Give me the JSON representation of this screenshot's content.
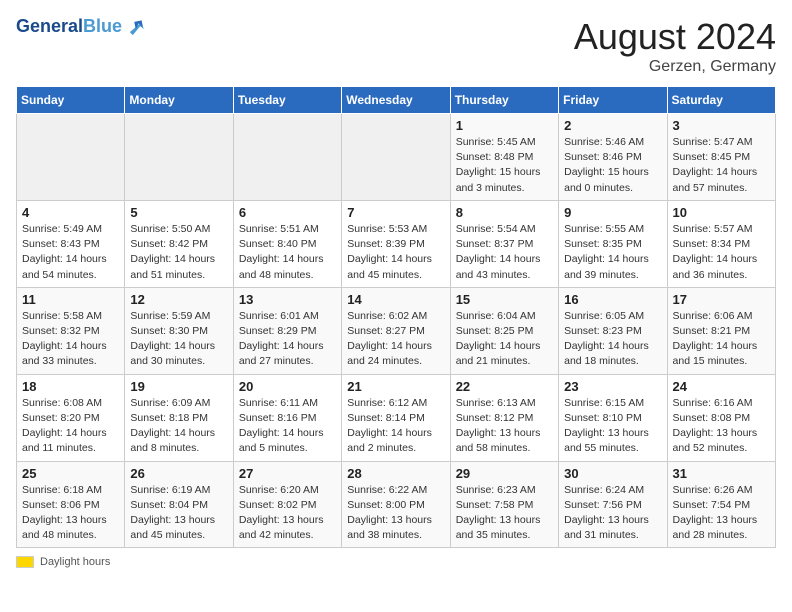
{
  "header": {
    "logo_line1": "General",
    "logo_line2": "Blue",
    "month_title": "August 2024",
    "location": "Gerzen, Germany"
  },
  "days_of_week": [
    "Sunday",
    "Monday",
    "Tuesday",
    "Wednesday",
    "Thursday",
    "Friday",
    "Saturday"
  ],
  "weeks": [
    [
      {
        "day": "",
        "info": ""
      },
      {
        "day": "",
        "info": ""
      },
      {
        "day": "",
        "info": ""
      },
      {
        "day": "",
        "info": ""
      },
      {
        "day": "1",
        "info": "Sunrise: 5:45 AM\nSunset: 8:48 PM\nDaylight: 15 hours\nand 3 minutes."
      },
      {
        "day": "2",
        "info": "Sunrise: 5:46 AM\nSunset: 8:46 PM\nDaylight: 15 hours\nand 0 minutes."
      },
      {
        "day": "3",
        "info": "Sunrise: 5:47 AM\nSunset: 8:45 PM\nDaylight: 14 hours\nand 57 minutes."
      }
    ],
    [
      {
        "day": "4",
        "info": "Sunrise: 5:49 AM\nSunset: 8:43 PM\nDaylight: 14 hours\nand 54 minutes."
      },
      {
        "day": "5",
        "info": "Sunrise: 5:50 AM\nSunset: 8:42 PM\nDaylight: 14 hours\nand 51 minutes."
      },
      {
        "day": "6",
        "info": "Sunrise: 5:51 AM\nSunset: 8:40 PM\nDaylight: 14 hours\nand 48 minutes."
      },
      {
        "day": "7",
        "info": "Sunrise: 5:53 AM\nSunset: 8:39 PM\nDaylight: 14 hours\nand 45 minutes."
      },
      {
        "day": "8",
        "info": "Sunrise: 5:54 AM\nSunset: 8:37 PM\nDaylight: 14 hours\nand 43 minutes."
      },
      {
        "day": "9",
        "info": "Sunrise: 5:55 AM\nSunset: 8:35 PM\nDaylight: 14 hours\nand 39 minutes."
      },
      {
        "day": "10",
        "info": "Sunrise: 5:57 AM\nSunset: 8:34 PM\nDaylight: 14 hours\nand 36 minutes."
      }
    ],
    [
      {
        "day": "11",
        "info": "Sunrise: 5:58 AM\nSunset: 8:32 PM\nDaylight: 14 hours\nand 33 minutes."
      },
      {
        "day": "12",
        "info": "Sunrise: 5:59 AM\nSunset: 8:30 PM\nDaylight: 14 hours\nand 30 minutes."
      },
      {
        "day": "13",
        "info": "Sunrise: 6:01 AM\nSunset: 8:29 PM\nDaylight: 14 hours\nand 27 minutes."
      },
      {
        "day": "14",
        "info": "Sunrise: 6:02 AM\nSunset: 8:27 PM\nDaylight: 14 hours\nand 24 minutes."
      },
      {
        "day": "15",
        "info": "Sunrise: 6:04 AM\nSunset: 8:25 PM\nDaylight: 14 hours\nand 21 minutes."
      },
      {
        "day": "16",
        "info": "Sunrise: 6:05 AM\nSunset: 8:23 PM\nDaylight: 14 hours\nand 18 minutes."
      },
      {
        "day": "17",
        "info": "Sunrise: 6:06 AM\nSunset: 8:21 PM\nDaylight: 14 hours\nand 15 minutes."
      }
    ],
    [
      {
        "day": "18",
        "info": "Sunrise: 6:08 AM\nSunset: 8:20 PM\nDaylight: 14 hours\nand 11 minutes."
      },
      {
        "day": "19",
        "info": "Sunrise: 6:09 AM\nSunset: 8:18 PM\nDaylight: 14 hours\nand 8 minutes."
      },
      {
        "day": "20",
        "info": "Sunrise: 6:11 AM\nSunset: 8:16 PM\nDaylight: 14 hours\nand 5 minutes."
      },
      {
        "day": "21",
        "info": "Sunrise: 6:12 AM\nSunset: 8:14 PM\nDaylight: 14 hours\nand 2 minutes."
      },
      {
        "day": "22",
        "info": "Sunrise: 6:13 AM\nSunset: 8:12 PM\nDaylight: 13 hours\nand 58 minutes."
      },
      {
        "day": "23",
        "info": "Sunrise: 6:15 AM\nSunset: 8:10 PM\nDaylight: 13 hours\nand 55 minutes."
      },
      {
        "day": "24",
        "info": "Sunrise: 6:16 AM\nSunset: 8:08 PM\nDaylight: 13 hours\nand 52 minutes."
      }
    ],
    [
      {
        "day": "25",
        "info": "Sunrise: 6:18 AM\nSunset: 8:06 PM\nDaylight: 13 hours\nand 48 minutes."
      },
      {
        "day": "26",
        "info": "Sunrise: 6:19 AM\nSunset: 8:04 PM\nDaylight: 13 hours\nand 45 minutes."
      },
      {
        "day": "27",
        "info": "Sunrise: 6:20 AM\nSunset: 8:02 PM\nDaylight: 13 hours\nand 42 minutes."
      },
      {
        "day": "28",
        "info": "Sunrise: 6:22 AM\nSunset: 8:00 PM\nDaylight: 13 hours\nand 38 minutes."
      },
      {
        "day": "29",
        "info": "Sunrise: 6:23 AM\nSunset: 7:58 PM\nDaylight: 13 hours\nand 35 minutes."
      },
      {
        "day": "30",
        "info": "Sunrise: 6:24 AM\nSunset: 7:56 PM\nDaylight: 13 hours\nand 31 minutes."
      },
      {
        "day": "31",
        "info": "Sunrise: 6:26 AM\nSunset: 7:54 PM\nDaylight: 13 hours\nand 28 minutes."
      }
    ]
  ],
  "footer": {
    "label": "Daylight hours"
  }
}
